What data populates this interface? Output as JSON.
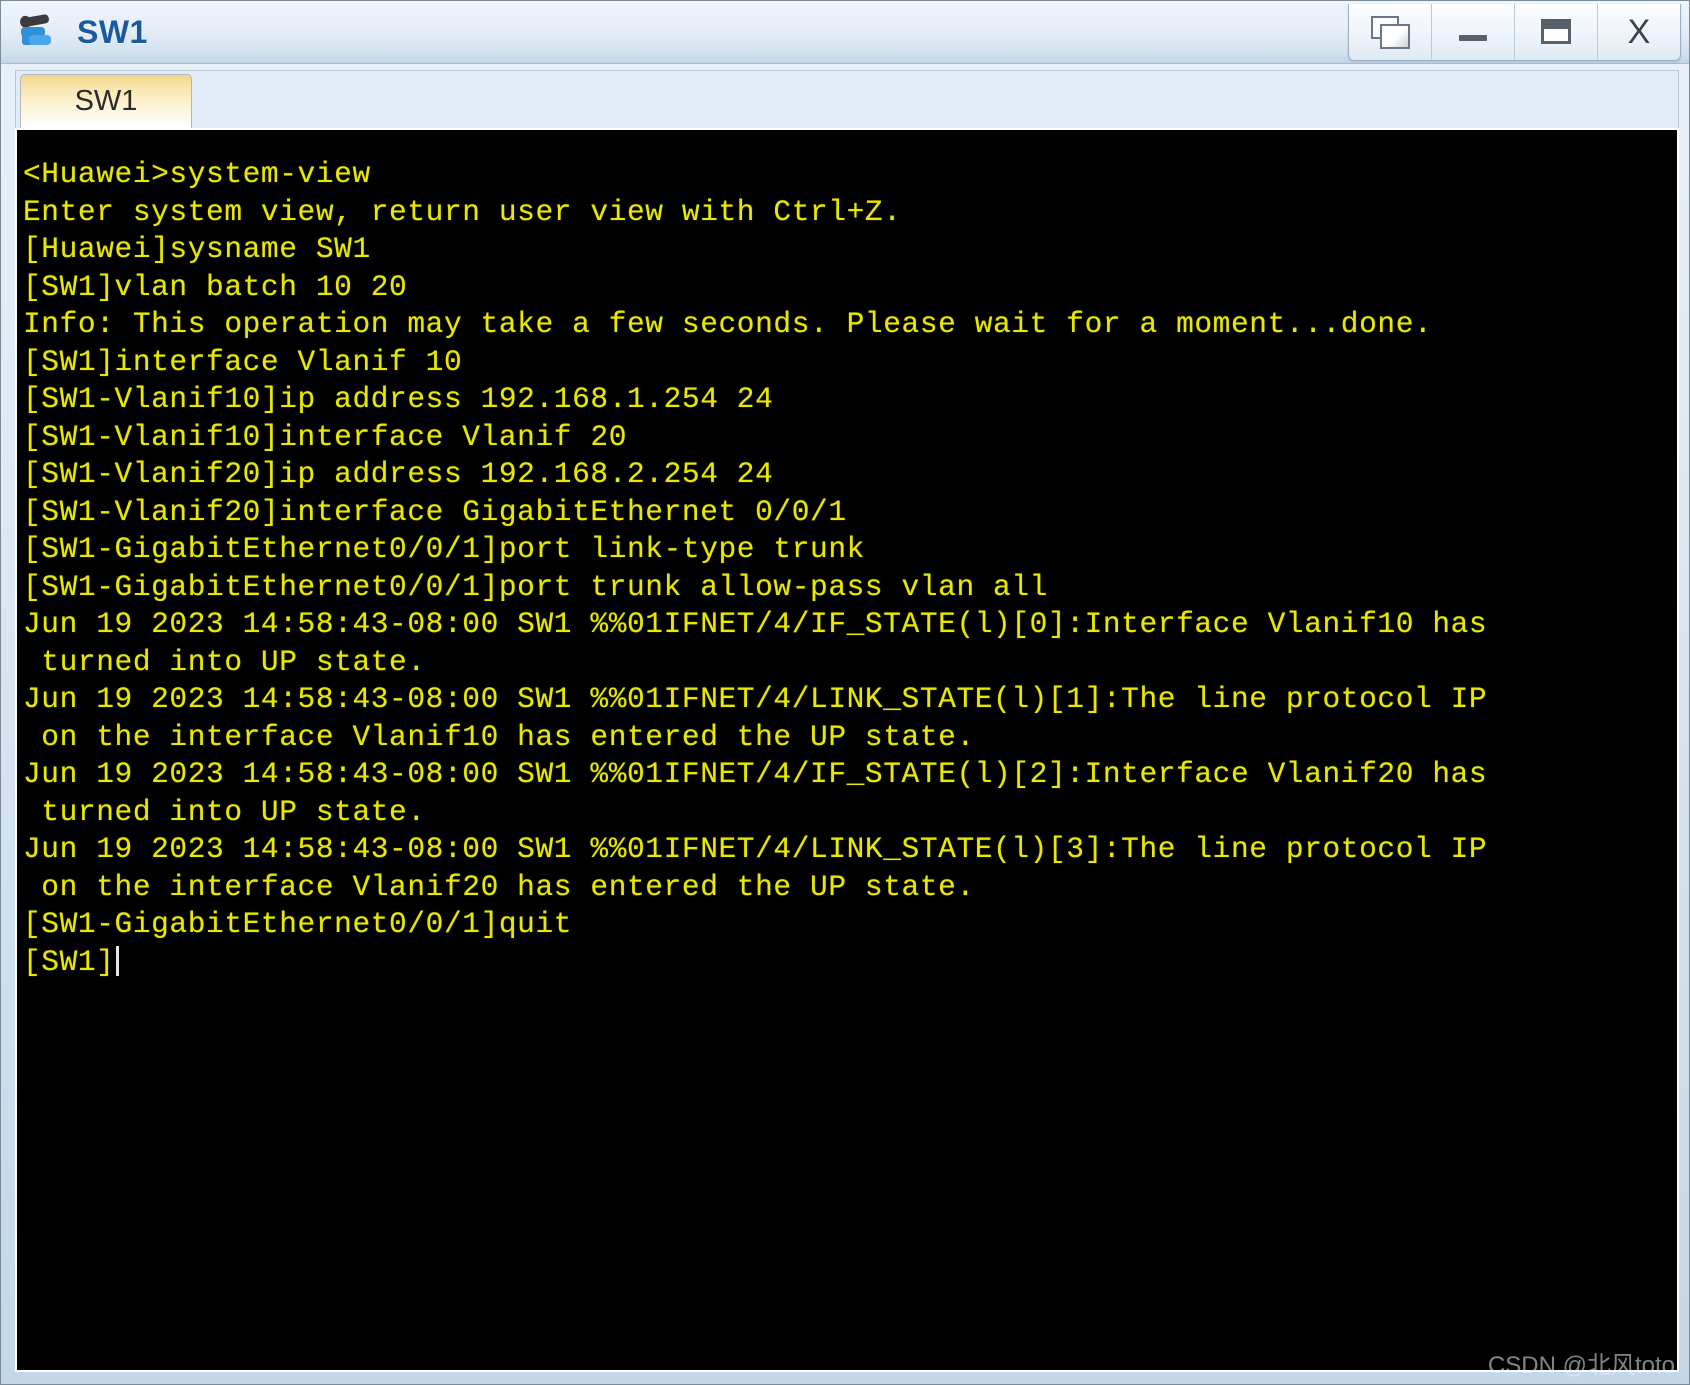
{
  "window": {
    "title": "SW1",
    "icon": "switch-device-icon",
    "controls": [
      {
        "name": "restore-button",
        "icon": "restore-window-icon",
        "label": ""
      },
      {
        "name": "minimize-button",
        "icon": "minimize-icon",
        "label": ""
      },
      {
        "name": "maximize-button",
        "icon": "maximize-icon",
        "label": ""
      },
      {
        "name": "close-button",
        "icon": "close-icon",
        "label": "X"
      }
    ]
  },
  "tabs": [
    {
      "label": "SW1",
      "active": true
    }
  ],
  "terminal": {
    "background_color": "#000000",
    "text_color": "#e8e800",
    "cursor_color": "#e6e6e6",
    "prompt_current": "[SW1]",
    "lines": [
      "<Huawei>system-view",
      "Enter system view, return user view with Ctrl+Z.",
      "[Huawei]sysname SW1",
      "[SW1]vlan batch 10 20",
      "Info: This operation may take a few seconds. Please wait for a moment...done.",
      "[SW1]interface Vlanif 10",
      "[SW1-Vlanif10]ip address 192.168.1.254 24",
      "[SW1-Vlanif10]interface Vlanif 20",
      "[SW1-Vlanif20]ip address 192.168.2.254 24",
      "[SW1-Vlanif20]interface GigabitEthernet 0/0/1",
      "[SW1-GigabitEthernet0/0/1]port link-type trunk",
      "[SW1-GigabitEthernet0/0/1]port trunk allow-pass vlan all",
      "Jun 19 2023 14:58:43-08:00 SW1 %%01IFNET/4/IF_STATE(l)[0]:Interface Vlanif10 has",
      " turned into UP state.",
      "Jun 19 2023 14:58:43-08:00 SW1 %%01IFNET/4/LINK_STATE(l)[1]:The line protocol IP",
      " on the interface Vlanif10 has entered the UP state.",
      "Jun 19 2023 14:58:43-08:00 SW1 %%01IFNET/4/IF_STATE(l)[2]:Interface Vlanif20 has",
      " turned into UP state.",
      "Jun 19 2023 14:58:43-08:00 SW1 %%01IFNET/4/LINK_STATE(l)[3]:The line protocol IP",
      " on the interface Vlanif20 has entered the UP state.",
      "[SW1-GigabitEthernet0/0/1]quit"
    ]
  },
  "watermark": {
    "text": "CSDN @北风toto"
  }
}
